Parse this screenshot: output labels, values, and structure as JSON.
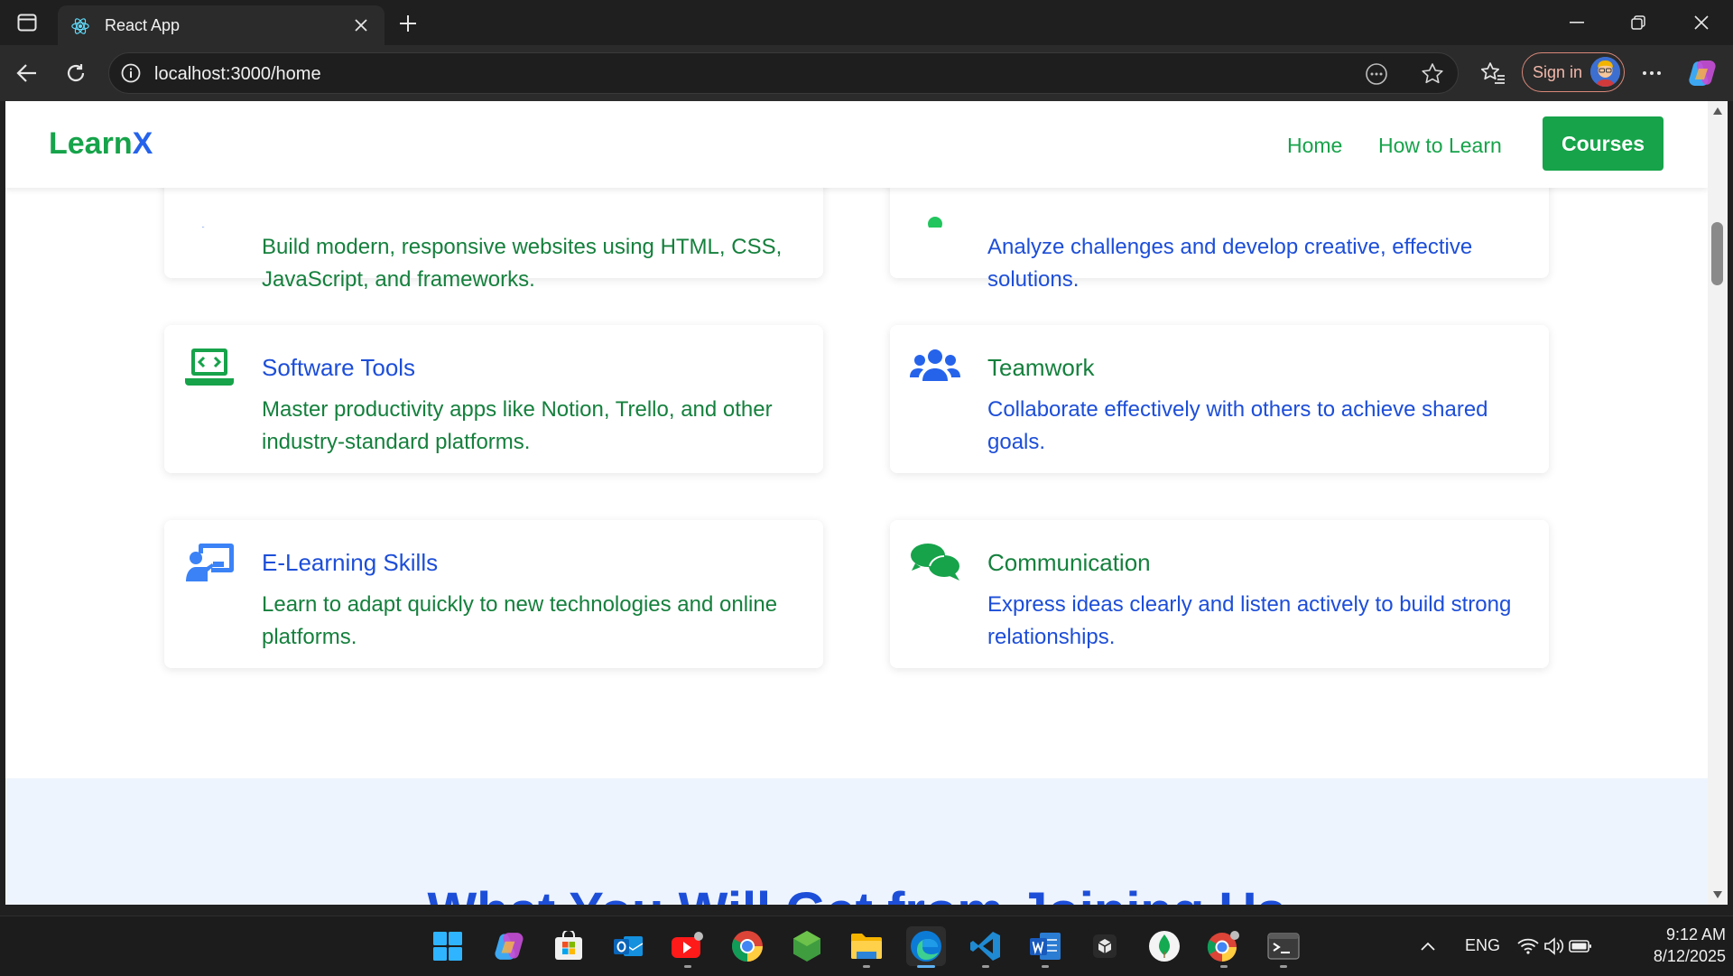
{
  "browser": {
    "tab_title": "React App",
    "url": "localhost:3000/home",
    "sign_in_label": "Sign in"
  },
  "site": {
    "logo_part1": "Learn",
    "logo_part2": "X",
    "nav": {
      "home": "Home",
      "how_to_learn": "How to Learn",
      "courses": "Courses"
    }
  },
  "cards": [
    {
      "icon": "code-icon",
      "title": "",
      "desc": "Build modern, responsive websites using HTML, CSS, JavaScript, and frameworks."
    },
    {
      "icon": "lightbulb-icon",
      "title": "",
      "desc": "Analyze challenges and develop creative, effective solutions."
    },
    {
      "icon": "laptop-code-icon",
      "title": "Software Tools",
      "desc": "Master productivity apps like Notion, Trello, and other industry-standard platforms."
    },
    {
      "icon": "users-icon",
      "title": "Teamwork",
      "desc": "Collaborate effectively with others to achieve shared goals."
    },
    {
      "icon": "chalkboard-teacher-icon",
      "title": "E-Learning Skills",
      "desc": "Learn to adapt quickly to new technologies and online platforms."
    },
    {
      "icon": "comments-icon",
      "title": "Communication",
      "desc": "Express ideas clearly and listen actively to build strong relationships."
    }
  ],
  "section2": {
    "heading": "What You Will Get from Joining Us"
  },
  "taskbar": {
    "language": "ENG",
    "time": "9:12 AM",
    "date": "8/12/2025"
  },
  "colors": {
    "brand_green": "#16a34a",
    "brand_blue": "#2563eb",
    "section_bg": "#eef4fd"
  }
}
